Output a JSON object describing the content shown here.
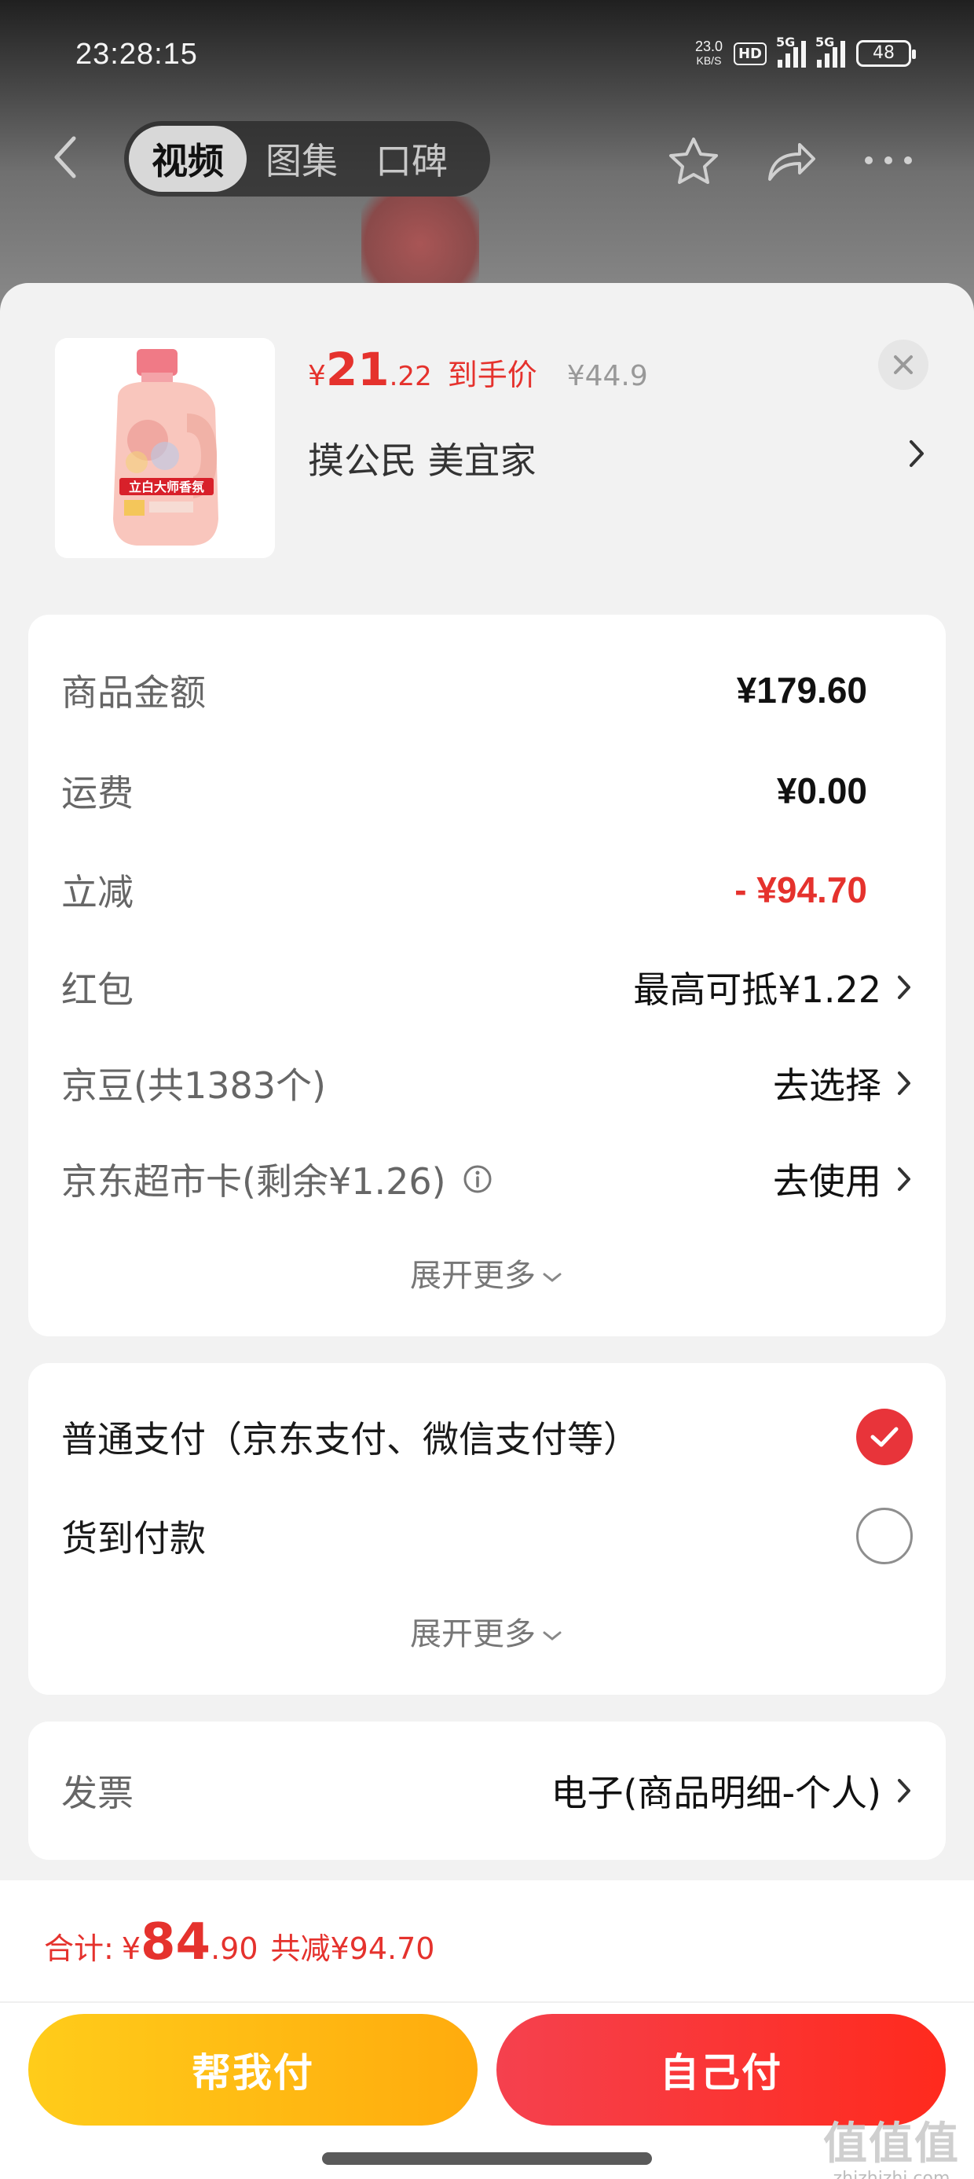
{
  "status_bar": {
    "time": "23:28:15",
    "net_speed_value": "23.0",
    "net_speed_unit": "KB/S",
    "hd_badge": "HD",
    "signal1_label": "5G",
    "signal2_label": "5G",
    "battery": "48"
  },
  "nav": {
    "tabs": [
      {
        "label": "视频",
        "active": true
      },
      {
        "label": "图集",
        "active": false
      },
      {
        "label": "口碑",
        "active": false
      }
    ],
    "icons": [
      "back-icon",
      "star-icon",
      "share-icon",
      "more-icon"
    ]
  },
  "product": {
    "price_symbol": "¥",
    "price_int": "21",
    "price_dec": ".22",
    "price_label": "到手价",
    "original_price": "¥44.9",
    "name": "摸公民  美宜家",
    "bottle_brand_text": "立白大师香氛"
  },
  "costs": {
    "rows": [
      {
        "label": "商品金额",
        "value": "¥179.60"
      },
      {
        "label": "运费",
        "value": "¥0.00"
      },
      {
        "label": "立减",
        "value": "- ¥94.70"
      },
      {
        "label": "红包",
        "value": "最高可抵¥1.22"
      },
      {
        "label": "京豆(共1383个)",
        "value": "去选择"
      },
      {
        "label": "京东超市卡(剩余¥1.26)",
        "value": "去使用"
      }
    ],
    "expand_label": "展开更多"
  },
  "payment": {
    "options": [
      {
        "label": "普通支付（京东支付、微信支付等）",
        "selected": true
      },
      {
        "label": "货到付款",
        "selected": false
      }
    ],
    "expand_label": "展开更多"
  },
  "invoice": {
    "label": "发票",
    "value": "电子(商品明细-个人)"
  },
  "footer": {
    "total_label": "合计:",
    "total_symbol": "¥",
    "total_int": "84",
    "total_dec": ".90",
    "discount": "共减¥94.70",
    "help_pay_label": "帮我付",
    "self_pay_label": "自己付"
  },
  "watermark": {
    "main": "值值值",
    "sub": "zhizhizhi.com"
  },
  "colors": {
    "accent_red": "#e5322d",
    "help_button": "#ffbb14",
    "self_button": "#f5414e",
    "sheet_bg": "#f2f2f2"
  }
}
